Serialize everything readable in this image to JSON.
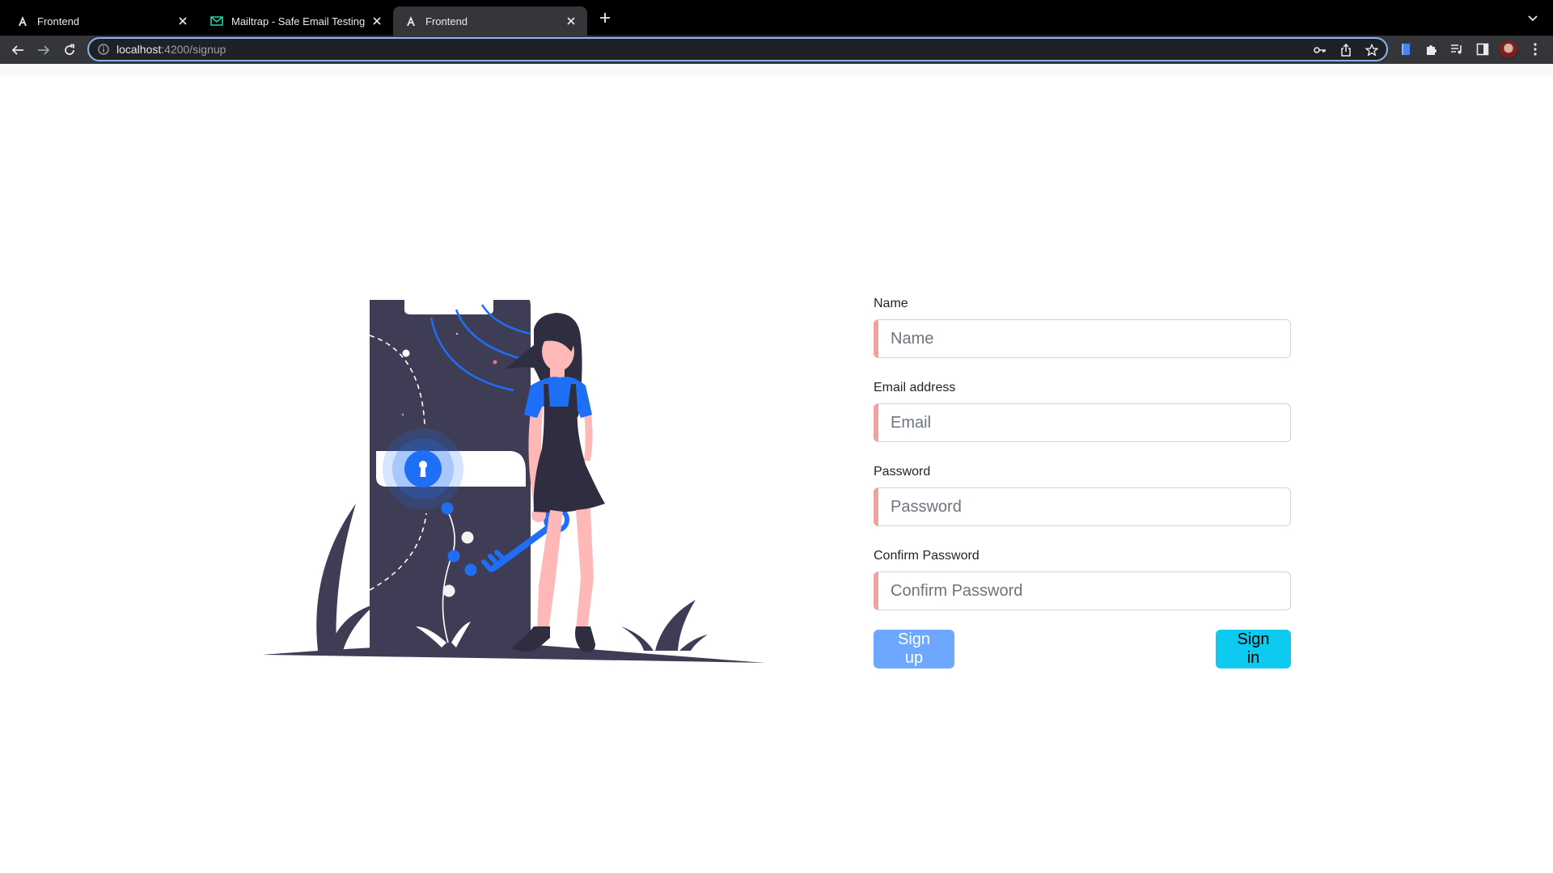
{
  "browser": {
    "tabs": [
      {
        "title": "Frontend",
        "icon": "angular-icon",
        "active": false
      },
      {
        "title": "Mailtrap - Safe Email Testing",
        "icon": "mailtrap-icon",
        "active": false
      },
      {
        "title": "Frontend",
        "icon": "angular-icon",
        "active": true
      }
    ],
    "url_host": "localhost",
    "url_rest": ":4200/signup"
  },
  "colors": {
    "accent_blue": "#1e6ff5",
    "dark_figure": "#3f3d56",
    "input_left_border": "#f0a29c",
    "signup_button": "#6ea8fe",
    "signin_button": "#0dcaf0"
  },
  "form": {
    "name_label": "Name",
    "name_placeholder": "Name",
    "email_label": "Email address",
    "email_placeholder": "Email",
    "password_label": "Password",
    "password_placeholder": "Password",
    "confirm_label": "Confirm Password",
    "confirm_placeholder": "Confirm Password",
    "signup_label": "Sign up",
    "signin_label": "Sign in"
  }
}
